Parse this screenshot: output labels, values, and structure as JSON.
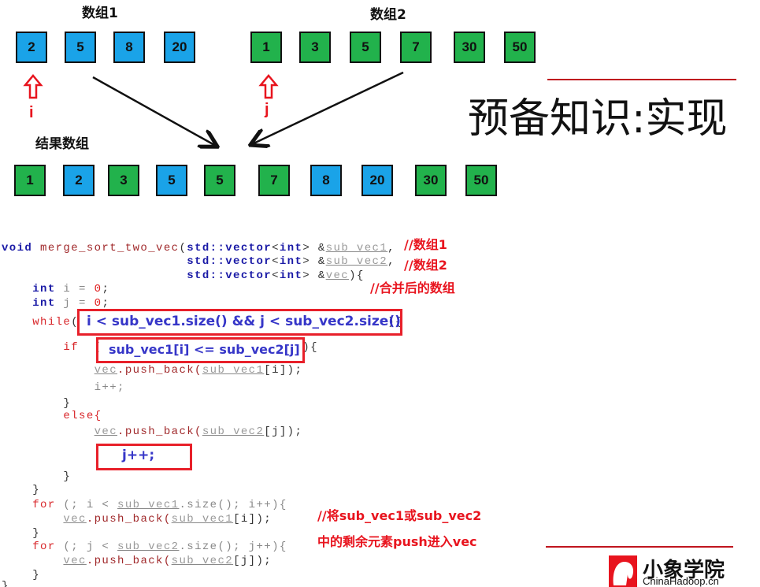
{
  "arrays": {
    "array1": {
      "title": "数组1",
      "values": [
        "2",
        "5",
        "8",
        "20"
      ],
      "color": "#1aa3e8"
    },
    "array2": {
      "title": "数组2",
      "values": [
        "1",
        "3",
        "5",
        "7",
        "30",
        "50"
      ],
      "color": "#22b24c"
    },
    "result": {
      "title": "结果数组",
      "values": [
        "1",
        "2",
        "3",
        "5",
        "5",
        "7",
        "8",
        "20",
        "30",
        "50"
      ],
      "colors": [
        "green",
        "blue",
        "green",
        "blue",
        "green",
        "green",
        "blue",
        "blue",
        "green",
        "green"
      ]
    },
    "pointer_i": "i",
    "pointer_j": "j"
  },
  "title": "预备知识:实现",
  "code": [
    [
      [
        "void ",
        "kw"
      ],
      [
        "merge_sort_two_vec",
        "fn"
      ],
      [
        "(",
        "sym"
      ],
      [
        "std::vector",
        "kw"
      ],
      [
        "<",
        "sym"
      ],
      [
        "int",
        "kw"
      ],
      [
        "> &",
        "sym"
      ],
      [
        "sub vec1",
        "var"
      ],
      [
        ",",
        "sym"
      ]
    ],
    [
      [
        "                        ",
        ""
      ],
      [
        "std::vector",
        "kw"
      ],
      [
        "<",
        "sym"
      ],
      [
        "int",
        "kw"
      ],
      [
        "> &",
        "sym"
      ],
      [
        "sub vec2",
        "var"
      ],
      [
        ",",
        "sym"
      ]
    ],
    [
      [
        "                        ",
        ""
      ],
      [
        "std::vector",
        "kw"
      ],
      [
        "<",
        "sym"
      ],
      [
        "int",
        "kw"
      ],
      [
        "> &",
        "sym"
      ],
      [
        "vec",
        "var"
      ],
      [
        "){",
        "sym"
      ]
    ],
    [
      [
        "    ",
        ""
      ],
      [
        "int",
        "kw"
      ],
      [
        " i = ",
        "plain"
      ],
      [
        "0",
        "num"
      ],
      [
        ";",
        "sym"
      ]
    ],
    [
      [
        "    ",
        ""
      ],
      [
        "int",
        "kw"
      ],
      [
        " j = ",
        "plain"
      ],
      [
        "0",
        "num"
      ],
      [
        ";",
        "sym"
      ]
    ],
    [
      [
        "    ",
        ""
      ],
      [
        "while",
        "red"
      ],
      [
        "(",
        "sym"
      ],
      [
        "                                        ",
        ""
      ],
      [
        "){",
        "sym"
      ]
    ],
    [
      [
        "        ",
        ""
      ],
      [
        "if",
        "red"
      ],
      [
        "  (",
        "sym"
      ],
      [
        "                          ",
        ""
      ],
      [
        "){",
        "sym"
      ]
    ],
    [
      [
        "            ",
        ""
      ],
      [
        "vec",
        "var"
      ],
      [
        ".push_back(",
        "fn"
      ],
      [
        "sub vec1",
        "var"
      ],
      [
        "[i]);",
        "sym"
      ]
    ],
    [
      [
        "            ",
        ""
      ],
      [
        "i++;",
        "plain"
      ]
    ],
    [
      [
        "        ",
        ""
      ],
      [
        "}",
        "sym"
      ]
    ],
    [
      [
        "        ",
        ""
      ],
      [
        "else{",
        "red"
      ]
    ],
    [
      [
        "            ",
        ""
      ],
      [
        "vec",
        "var"
      ],
      [
        ".push_back(",
        "fn"
      ],
      [
        "sub vec2",
        "var"
      ],
      [
        "[j]);",
        "sym"
      ]
    ],
    [
      [
        "        ",
        ""
      ],
      [
        "}",
        "sym"
      ]
    ],
    [
      [
        "    ",
        ""
      ],
      [
        "}",
        "sym"
      ]
    ],
    [
      [
        "    ",
        ""
      ],
      [
        "for",
        "red"
      ],
      [
        " (; i < ",
        "plain"
      ],
      [
        "sub vec1",
        "var"
      ],
      [
        ".size(); i++){",
        "plain"
      ]
    ],
    [
      [
        "        ",
        ""
      ],
      [
        "vec",
        "var"
      ],
      [
        ".push_back(",
        "fn"
      ],
      [
        "sub vec1",
        "var"
      ],
      [
        "[i]);",
        "sym"
      ]
    ],
    [
      [
        "    ",
        ""
      ],
      [
        "}",
        "sym"
      ]
    ],
    [
      [
        "    ",
        ""
      ],
      [
        "for",
        "red"
      ],
      [
        " (; j < ",
        "plain"
      ],
      [
        "sub vec2",
        "var"
      ],
      [
        ".size(); j++){",
        "plain"
      ]
    ],
    [
      [
        "        ",
        ""
      ],
      [
        "vec",
        "var"
      ],
      [
        ".push_back(",
        "fn"
      ],
      [
        "sub vec2",
        "var"
      ],
      [
        "[j]);",
        "sym"
      ]
    ],
    [
      [
        "    ",
        ""
      ],
      [
        "}",
        "sym"
      ]
    ],
    [
      [
        "}",
        "sym"
      ]
    ]
  ],
  "highlights": {
    "while_condition": "i < sub_vec1.size() && j < sub_vec2.size()",
    "if_condition": "sub_vec1[i] <= sub_vec2[j]",
    "j_increment": "j++;"
  },
  "comments": {
    "c1": "//数组1",
    "c2": "//数组2",
    "c3": "//合并后的数组",
    "c4": "//将sub_vec1或sub_vec2",
    "c5": "中的剩余元素push进入vec"
  },
  "logo": {
    "name": "小象学院",
    "domain": "ChinaHadoop.cn",
    "color": "#e8141e"
  }
}
